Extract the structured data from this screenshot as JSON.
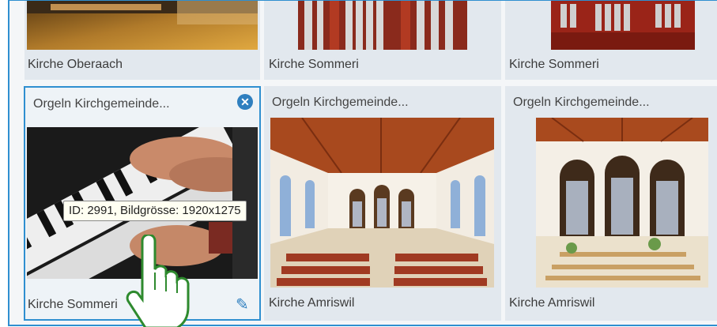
{
  "tiles": [
    {
      "header": "",
      "caption": "Kirche Oberaach"
    },
    {
      "header": "",
      "caption": "Kirche Sommeri"
    },
    {
      "header": "",
      "caption": "Kirche Sommeri"
    },
    {
      "header": "Orgeln Kirchgemeinde...",
      "caption": "Kirche Sommeri",
      "selected": true
    },
    {
      "header": "Orgeln Kirchgemeinde...",
      "caption": "Kirche Amriswil"
    },
    {
      "header": "Orgeln Kirchgemeinde...",
      "caption": "Kirche Amriswil"
    }
  ],
  "tooltip": "ID: 2991, Bildgrösse: 1920x1275",
  "icons": {
    "remove": "close-circle-icon",
    "edit": "pencil-icon",
    "cursor": "hand-pointer-icon"
  },
  "colors": {
    "accent": "#2f8fd0",
    "tile": "#e2e8ee"
  }
}
